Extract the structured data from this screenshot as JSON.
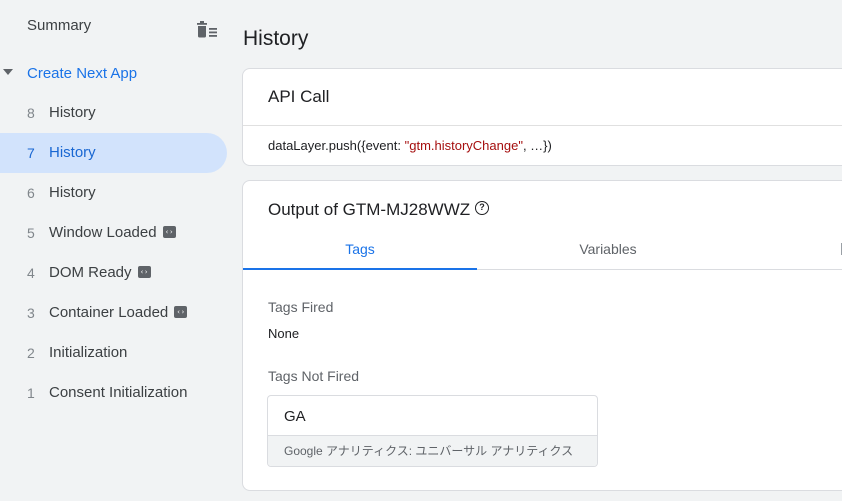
{
  "sidebar": {
    "summary_label": "Summary",
    "container_label": "Create Next App",
    "events": [
      {
        "num": "8",
        "name": "History",
        "code_icon": false,
        "selected": false
      },
      {
        "num": "7",
        "name": "History",
        "code_icon": false,
        "selected": true
      },
      {
        "num": "6",
        "name": "History",
        "code_icon": false,
        "selected": false
      },
      {
        "num": "5",
        "name": "Window Loaded",
        "code_icon": true,
        "selected": false
      },
      {
        "num": "4",
        "name": "DOM Ready",
        "code_icon": true,
        "selected": false
      },
      {
        "num": "3",
        "name": "Container Loaded",
        "code_icon": true,
        "selected": false
      },
      {
        "num": "2",
        "name": "Initialization",
        "code_icon": false,
        "selected": false
      },
      {
        "num": "1",
        "name": "Consent Initialization",
        "code_icon": false,
        "selected": false
      }
    ]
  },
  "main": {
    "title": "History",
    "api_card": {
      "title": "API Call",
      "code_prefix": "dataLayer.push({event: ",
      "code_string": "\"gtm.historyChange\"",
      "code_suffix": ", …})"
    },
    "output_card": {
      "title": "Output of GTM-MJ28WWZ",
      "help_icon": "?",
      "tabs": [
        {
          "label": "Tags",
          "active": true
        },
        {
          "label": "Variables",
          "active": false
        }
      ],
      "tags_fired_label": "Tags Fired",
      "tags_fired_value": "None",
      "tags_not_fired_label": "Tags Not Fired",
      "not_fired_tags": [
        {
          "name": "GA",
          "type": "Google アナリティクス: ユニバーサル アナリティクス"
        }
      ]
    }
  },
  "colors": {
    "accent": "#1a73e8",
    "selected_bg": "#d2e3fc",
    "code_string": "#a50e0e",
    "background": "#f1f3f4"
  }
}
